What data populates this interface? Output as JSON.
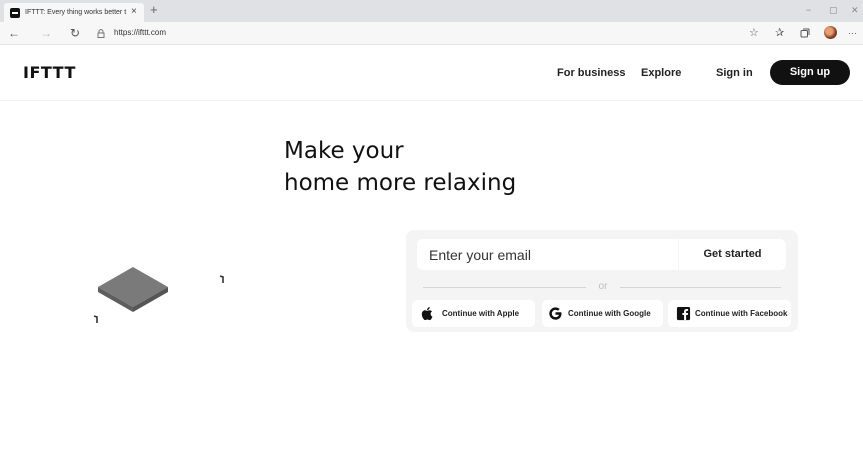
{
  "browser": {
    "tab_title": "IFTTT: Every thing works better t",
    "tab_close": "×",
    "new_tab": "+",
    "url": "https://ifttt.com",
    "window_controls": [
      "−",
      "▢",
      "✕"
    ],
    "toolbar_more": "···"
  },
  "header": {
    "logo": "IFTTT",
    "nav": {
      "for_business": "For business",
      "explore": "Explore",
      "sign_in": "Sign in",
      "sign_up": "Sign up"
    }
  },
  "hero": {
    "title_line1": "Make your",
    "title_line2": "home more relaxing"
  },
  "signup": {
    "email_placeholder": "Enter your email",
    "get_started": "Get started",
    "or": "or",
    "social": [
      {
        "label": "Continue with Apple",
        "icon": "apple-icon"
      },
      {
        "label": "Continue with Google",
        "icon": "google-icon"
      },
      {
        "label": "Continue with Facebook",
        "icon": "facebook-icon"
      }
    ]
  },
  "colors": {
    "primary": "#111111",
    "card_background": "#f4f4f4",
    "divider": "#d6d6d6"
  }
}
